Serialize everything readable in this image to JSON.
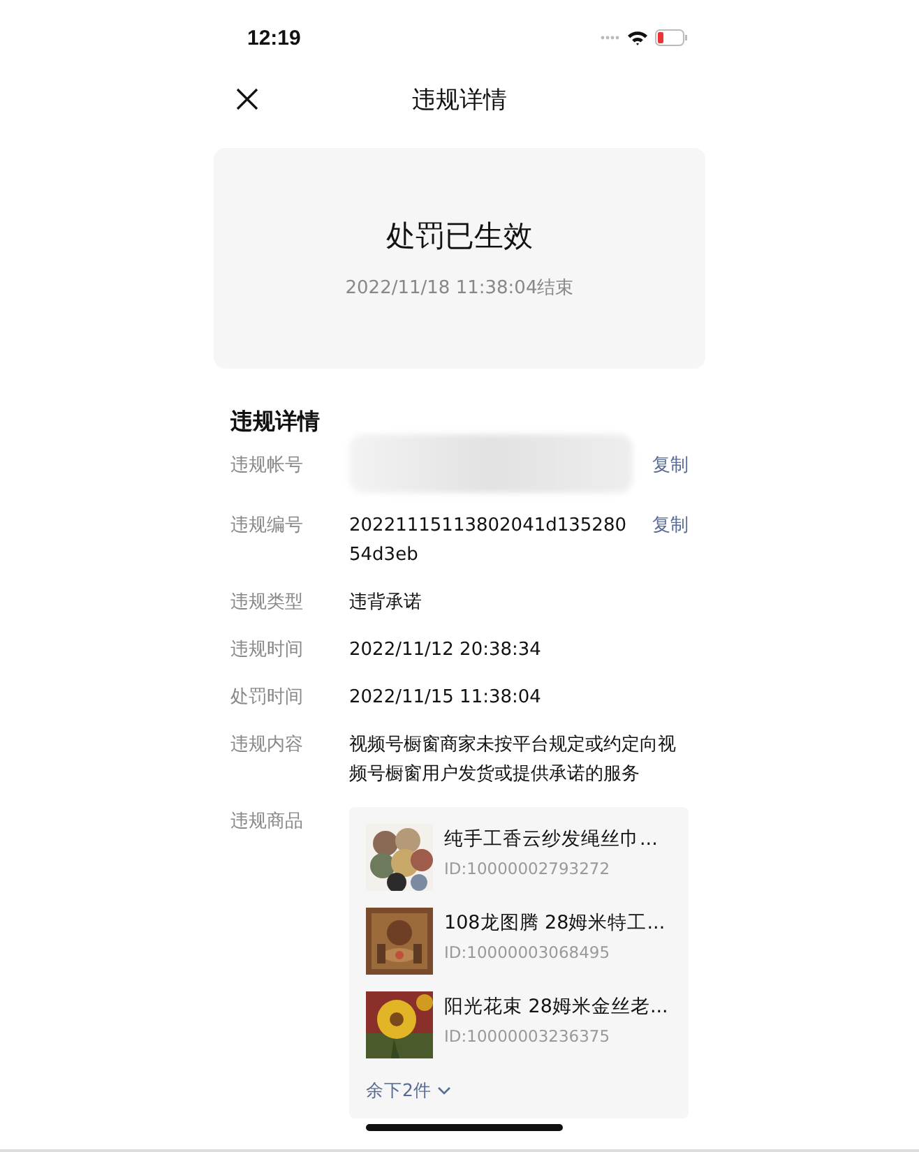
{
  "status_bar": {
    "time": "12:19"
  },
  "nav": {
    "title": "违规详情"
  },
  "status_card": {
    "title": "处罚已生效",
    "subtitle": "2022/11/18 11:38:04结束"
  },
  "section": {
    "title": "违规详情"
  },
  "fields": [
    {
      "label": "违规帐号",
      "kind": "redacted",
      "action": "复制"
    },
    {
      "label": "违规编号",
      "kind": "text",
      "value": "20221115113802041d13528054d3eb",
      "action": "复制"
    },
    {
      "label": "违规类型",
      "kind": "text",
      "value": "违背承诺"
    },
    {
      "label": "违规时间",
      "kind": "text",
      "value": "2022/11/12 20:38:34"
    },
    {
      "label": "处罚时间",
      "kind": "text",
      "value": "2022/11/15 11:38:04"
    },
    {
      "label": "违规内容",
      "kind": "text",
      "value": "视频号橱窗商家未按平台规定或约定向视频号橱窗用户发货或提供承诺的服务"
    }
  ],
  "products": {
    "label": "违规商品",
    "items": [
      {
        "name": "纯手工香云纱发绳丝巾...",
        "id": "ID:10000002793272",
        "kind": "picture"
      },
      {
        "name": "108龙图腾 28姆米特工...",
        "id": "ID:10000003068495",
        "kind": "picture"
      },
      {
        "name": "阳光花束 28姆米金丝老...",
        "id": "ID:10000003236375",
        "kind": "picture"
      }
    ],
    "more": "余下2件"
  }
}
